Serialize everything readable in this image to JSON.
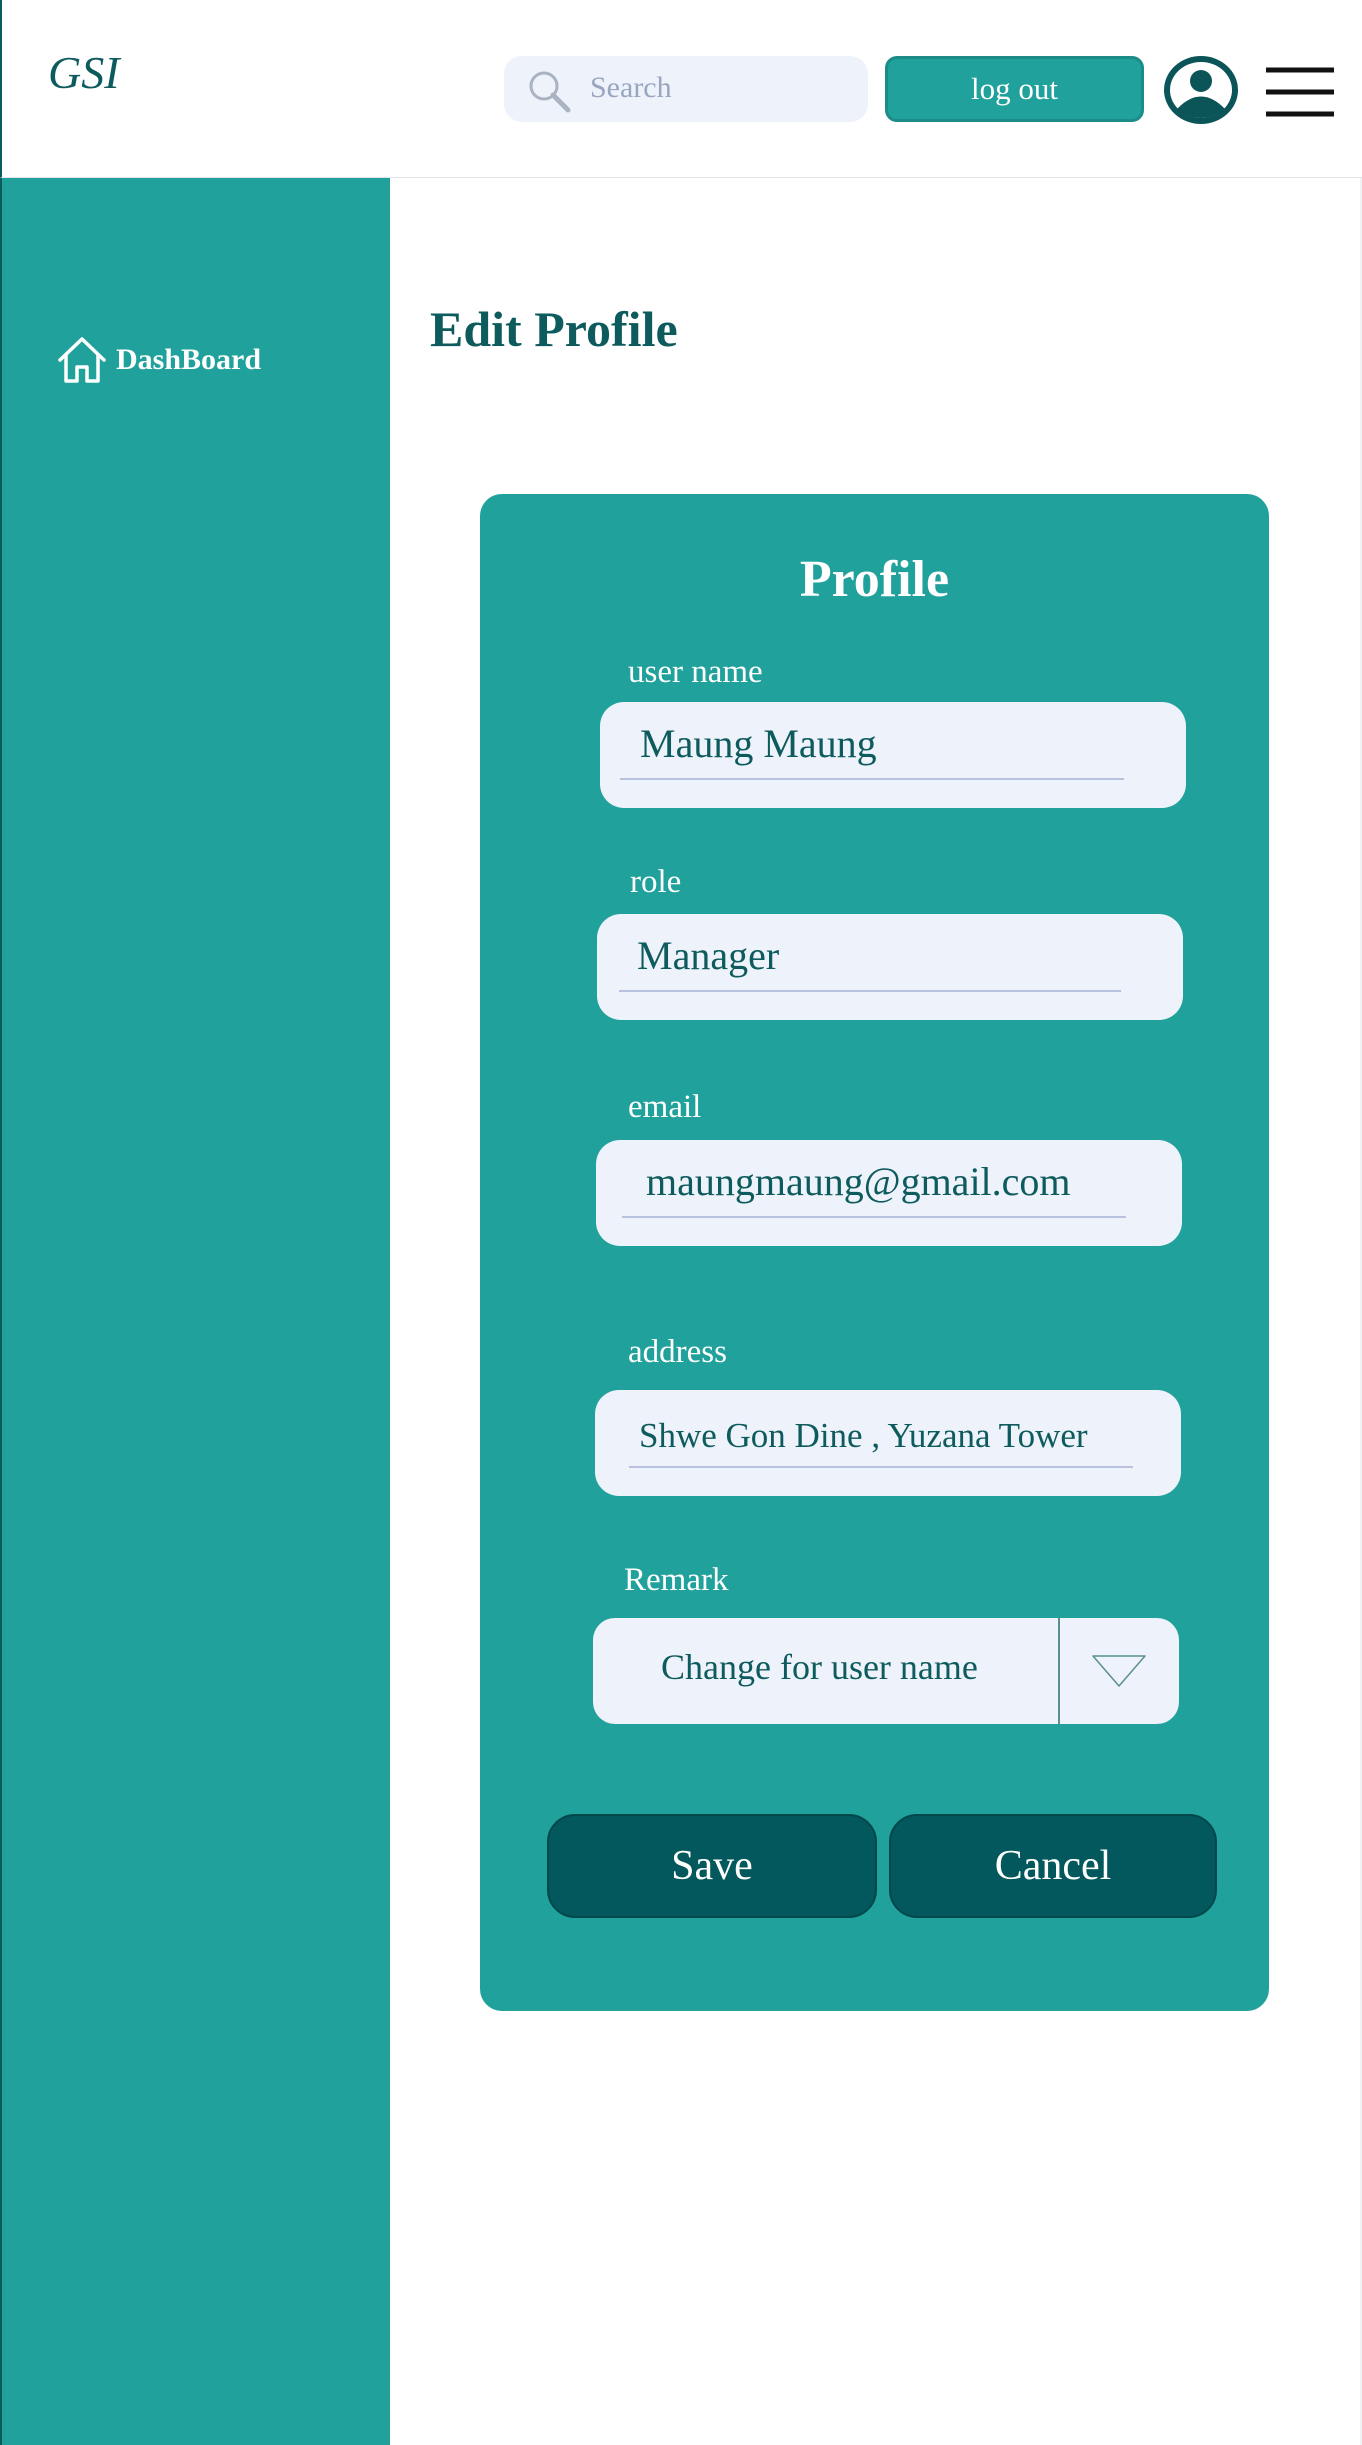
{
  "header": {
    "logo": "GSI",
    "search_placeholder": "Search",
    "logout_label": "log out"
  },
  "sidebar": {
    "items": [
      {
        "label": "DashBoard",
        "icon": "home-icon"
      }
    ]
  },
  "page": {
    "title": "Edit Profile"
  },
  "form": {
    "title": "Profile",
    "fields": {
      "user_name": {
        "label": "user name",
        "value": "Maung Maung"
      },
      "role": {
        "label": "role",
        "value": "Manager"
      },
      "email": {
        "label": "email",
        "value": "maungmaung@gmail.com"
      },
      "address": {
        "label": "address",
        "value": "Shwe Gon Dine , Yuzana Tower"
      }
    },
    "remark": {
      "label": "Remark",
      "selected": "Change for user name"
    },
    "save_label": "Save",
    "cancel_label": "Cancel"
  },
  "colors": {
    "accent": "#20a19c",
    "dark": "#02585c",
    "title": "#0e5b5d",
    "field_bg": "#eef2fb"
  }
}
